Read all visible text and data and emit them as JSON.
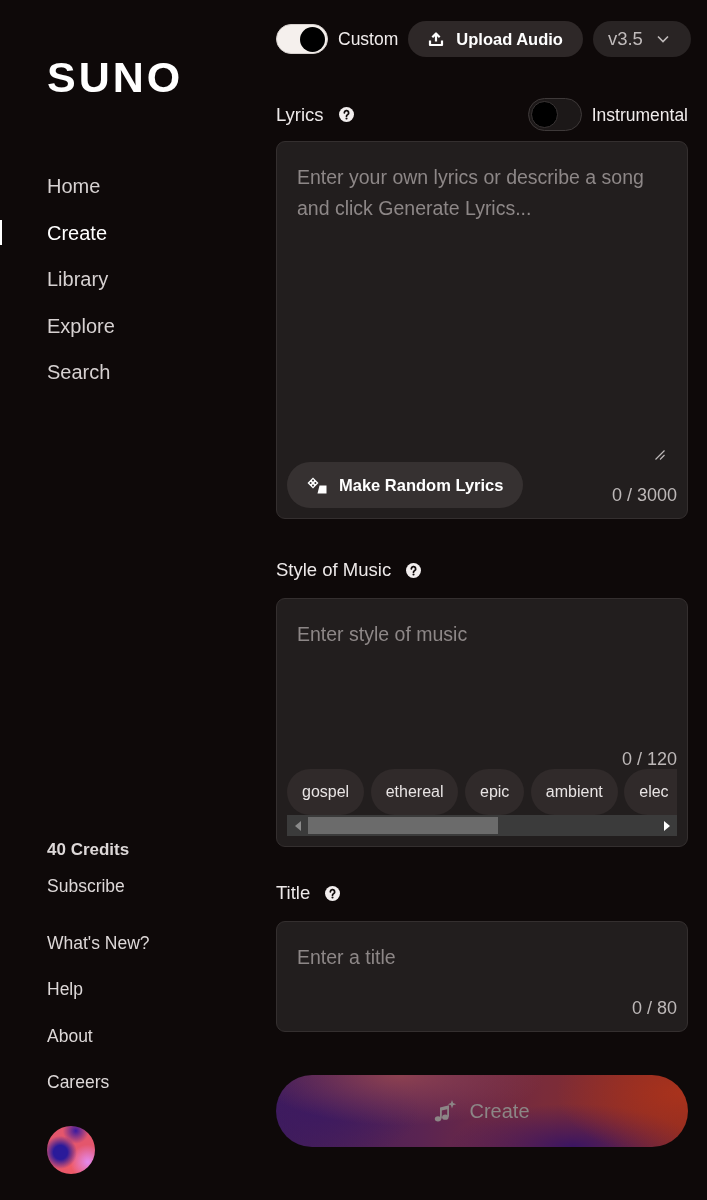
{
  "logo": {
    "text": "SUNO"
  },
  "sidebar": {
    "items": [
      {
        "label": "Home",
        "selected": false
      },
      {
        "label": "Create",
        "selected": true
      },
      {
        "label": "Library",
        "selected": false
      },
      {
        "label": "Explore",
        "selected": false
      },
      {
        "label": "Search",
        "selected": false
      }
    ],
    "credits": "40 Credits",
    "subscribe": "Subscribe",
    "links": [
      "What's New?",
      "Help",
      "About",
      "Careers"
    ]
  },
  "toolbar": {
    "custom_toggle": {
      "label": "Custom",
      "on": true
    },
    "upload_button": "Upload Audio",
    "version_select": {
      "value": "v3.5"
    }
  },
  "lyrics": {
    "label": "Lyrics",
    "instrumental_toggle": {
      "label": "Instrumental",
      "on": false
    },
    "placeholder": "Enter your own lyrics or describe a song and click Generate Lyrics...",
    "random_button": "Make Random Lyrics",
    "counter": "0 / 3000"
  },
  "style_of_music": {
    "label": "Style of Music",
    "placeholder": "Enter style of music",
    "counter": "0 / 120",
    "tags": [
      "gospel",
      "ethereal",
      "epic",
      "ambient",
      "elec"
    ]
  },
  "title": {
    "label": "Title",
    "placeholder": "Enter a title",
    "counter": "0 / 80"
  },
  "create_button": {
    "label": "Create",
    "disabled": true
  }
}
